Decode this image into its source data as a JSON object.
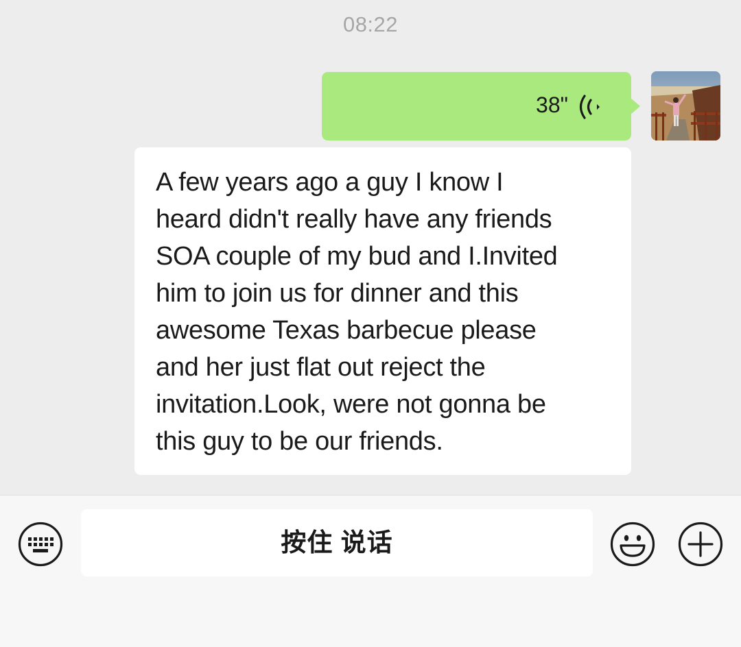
{
  "chat": {
    "timestamp": "08:22",
    "messages": [
      {
        "type": "voice",
        "sender": "self",
        "duration": "38\"",
        "icon": "voice-wave-icon"
      },
      {
        "type": "text",
        "sender": "self",
        "lines": [
          "A few years ago a guy I know I",
          "heard didn't really have any friends",
          "SOA couple of my bud and I.Invited",
          "him to join us for dinner and this",
          "awesome Texas barbecue please",
          "and her just flat out reject the",
          "invitation.Look, were not gonna be",
          "this guy to be our friends."
        ]
      }
    ]
  },
  "input_bar": {
    "hold_to_talk_label": "按住 说话",
    "left_icon": "keyboard-icon",
    "right_icons": [
      "emoji-icon",
      "plus-icon"
    ]
  },
  "colors": {
    "chat_background": "#ededed",
    "voice_bubble": "#a9e97e",
    "text_bubble": "#ffffff",
    "timestamp": "#a6a6a6",
    "input_bar_background": "#f7f7f7"
  }
}
